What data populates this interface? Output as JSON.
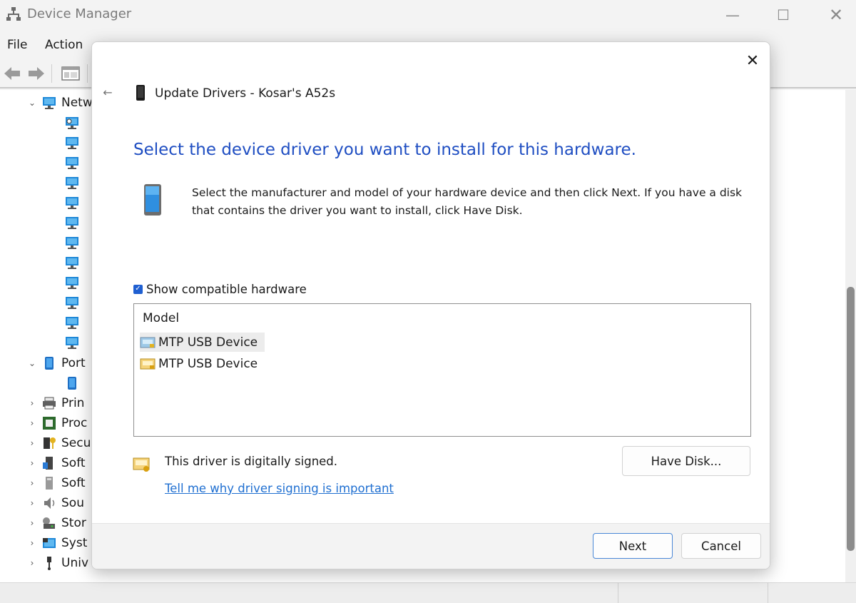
{
  "device_manager": {
    "title": "Device Manager",
    "window_buttons": {
      "minimize": "—",
      "maximize": "☐",
      "close": "✕"
    },
    "menu": [
      "File",
      "Action"
    ],
    "tree": [
      {
        "label": "Netw",
        "expanded": true,
        "icon": "network-adapter-icon"
      },
      {
        "label": "Port",
        "expanded": true,
        "icon": "port-icon"
      },
      {
        "label": "Prin",
        "icon": "printer-icon"
      },
      {
        "label": "Proc",
        "icon": "processor-icon"
      },
      {
        "label": "Secu",
        "icon": "security-icon"
      },
      {
        "label": "Soft",
        "icon": "software-component-icon"
      },
      {
        "label": "Soft",
        "icon": "software-device-icon"
      },
      {
        "label": "Sou",
        "icon": "sound-icon"
      },
      {
        "label": "Stor",
        "icon": "storage-icon"
      },
      {
        "label": "Syst",
        "icon": "system-device-icon"
      },
      {
        "label": "Univ",
        "icon": "usb-icon"
      }
    ]
  },
  "dialog": {
    "close": "✕",
    "back": "←",
    "header": "Update Drivers - Kosar's A52s",
    "heading": "Select the device driver you want to install for this hardware.",
    "description": "Select the manufacturer and model of your hardware device and then click Next. If you have a disk that contains the driver you want to install, click Have Disk.",
    "show_compatible_label": "Show compatible hardware",
    "show_compatible_checked": true,
    "model_header": "Model",
    "models": [
      "MTP USB Device",
      "MTP USB Device"
    ],
    "signed_text": "This driver is digitally signed.",
    "signing_link": "Tell me why driver signing is important",
    "have_disk_label": "Have Disk...",
    "next_label": "Next",
    "cancel_label": "Cancel"
  },
  "colors": {
    "heading_blue": "#1f4ec2",
    "link_blue": "#1f6fd1",
    "checkbox_blue": "#1f5fd1"
  }
}
